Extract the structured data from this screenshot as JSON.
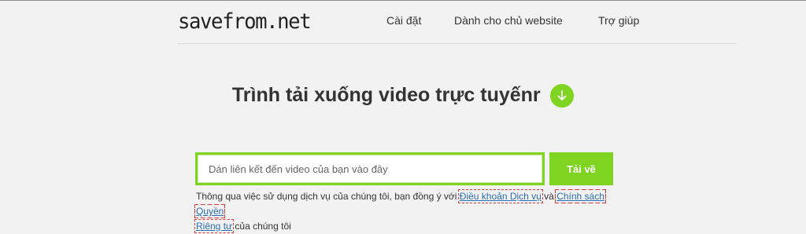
{
  "header": {
    "logo": "savefrom.net",
    "nav": [
      "Cài đặt",
      "Dành cho chủ website",
      "Trợ giúp"
    ]
  },
  "main": {
    "title": "Trình tải xuống video trực tuyếnr",
    "download_icon": "arrow-down-circle-icon",
    "search": {
      "placeholder": "Dán liên kết đến video của bạn vào đây",
      "value": ""
    },
    "download_button": "Tải về",
    "terms": {
      "text_before": "Thông qua việc sử dụng dịch vụ của chúng tôi, bạn đồng ý với ",
      "link_terms": "Điều khoản Dịch vụ",
      "text_and": " và ",
      "link_privacy_part1": "Chính sách Quyền",
      "link_privacy_part2": "Riêng tư",
      "text_after": " của chúng tôi"
    }
  },
  "colors": {
    "accent": "#7fd321",
    "link": "#2a6db0",
    "background": "#f2f2f2"
  }
}
